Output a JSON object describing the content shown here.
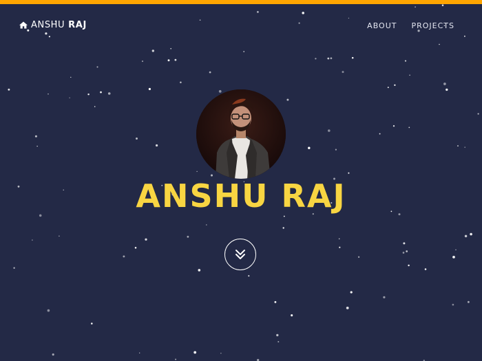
{
  "theme": {
    "background": "#232946",
    "accent_bar": "#ffa500",
    "name_color": "#f8d542",
    "star_color": "#ffffff"
  },
  "nav": {
    "brand_icon": "home-icon",
    "brand_first": "ANSHU",
    "brand_last": "RAJ",
    "links": [
      {
        "label": "ABOUT"
      },
      {
        "label": "PROJECTS"
      }
    ]
  },
  "hero": {
    "name": "ANSHU RAJ",
    "photo": "profile-photo",
    "scroll_icon": "double-chevron-down-icon"
  }
}
